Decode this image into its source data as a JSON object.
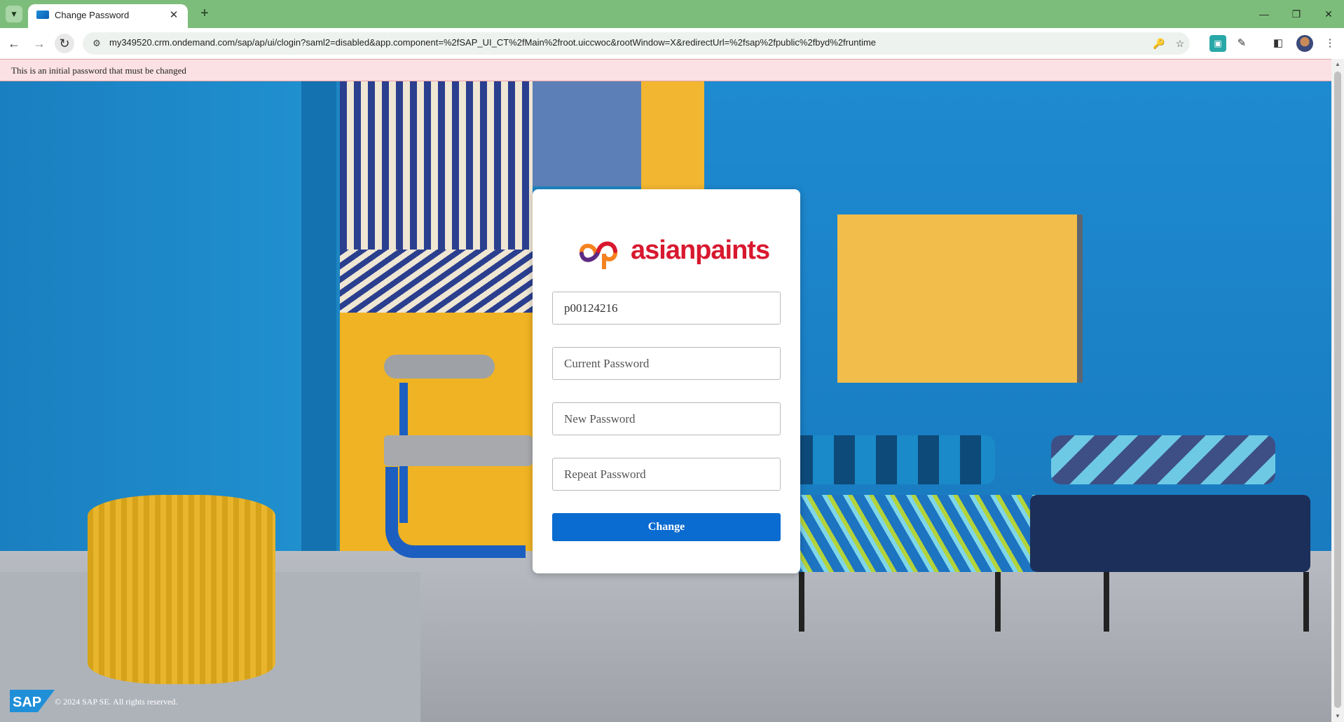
{
  "browser": {
    "tab_title": "Change Password",
    "url": "my349520.crm.ondemand.com/sap/ap/ui/clogin?saml2=disabled&app.component=%2fSAP_UI_CT%2fMain%2froot.uiccwoc&rootWindow=X&redirectUrl=%2fsap%2fpublic%2fbyd%2fruntime"
  },
  "banner": {
    "message": "This is an initial password that must be changed"
  },
  "login": {
    "logo_text": "asianpaints",
    "username_value": "p00124216",
    "current_password_placeholder": "Current Password",
    "new_password_placeholder": "New Password",
    "repeat_password_placeholder": "Repeat Password",
    "change_label": "Change"
  },
  "footer": {
    "sap_logo_text": "SAP",
    "copyright": "© 2024 SAP SE. All rights reserved."
  },
  "colors": {
    "tabstrip": "#7dbd7b",
    "primary_button": "#0a6bd0",
    "banner_bg": "#fbe1e3",
    "brand_red": "#d8182f",
    "brand_orange": "#f5821f",
    "brand_purple": "#5b2a86"
  }
}
